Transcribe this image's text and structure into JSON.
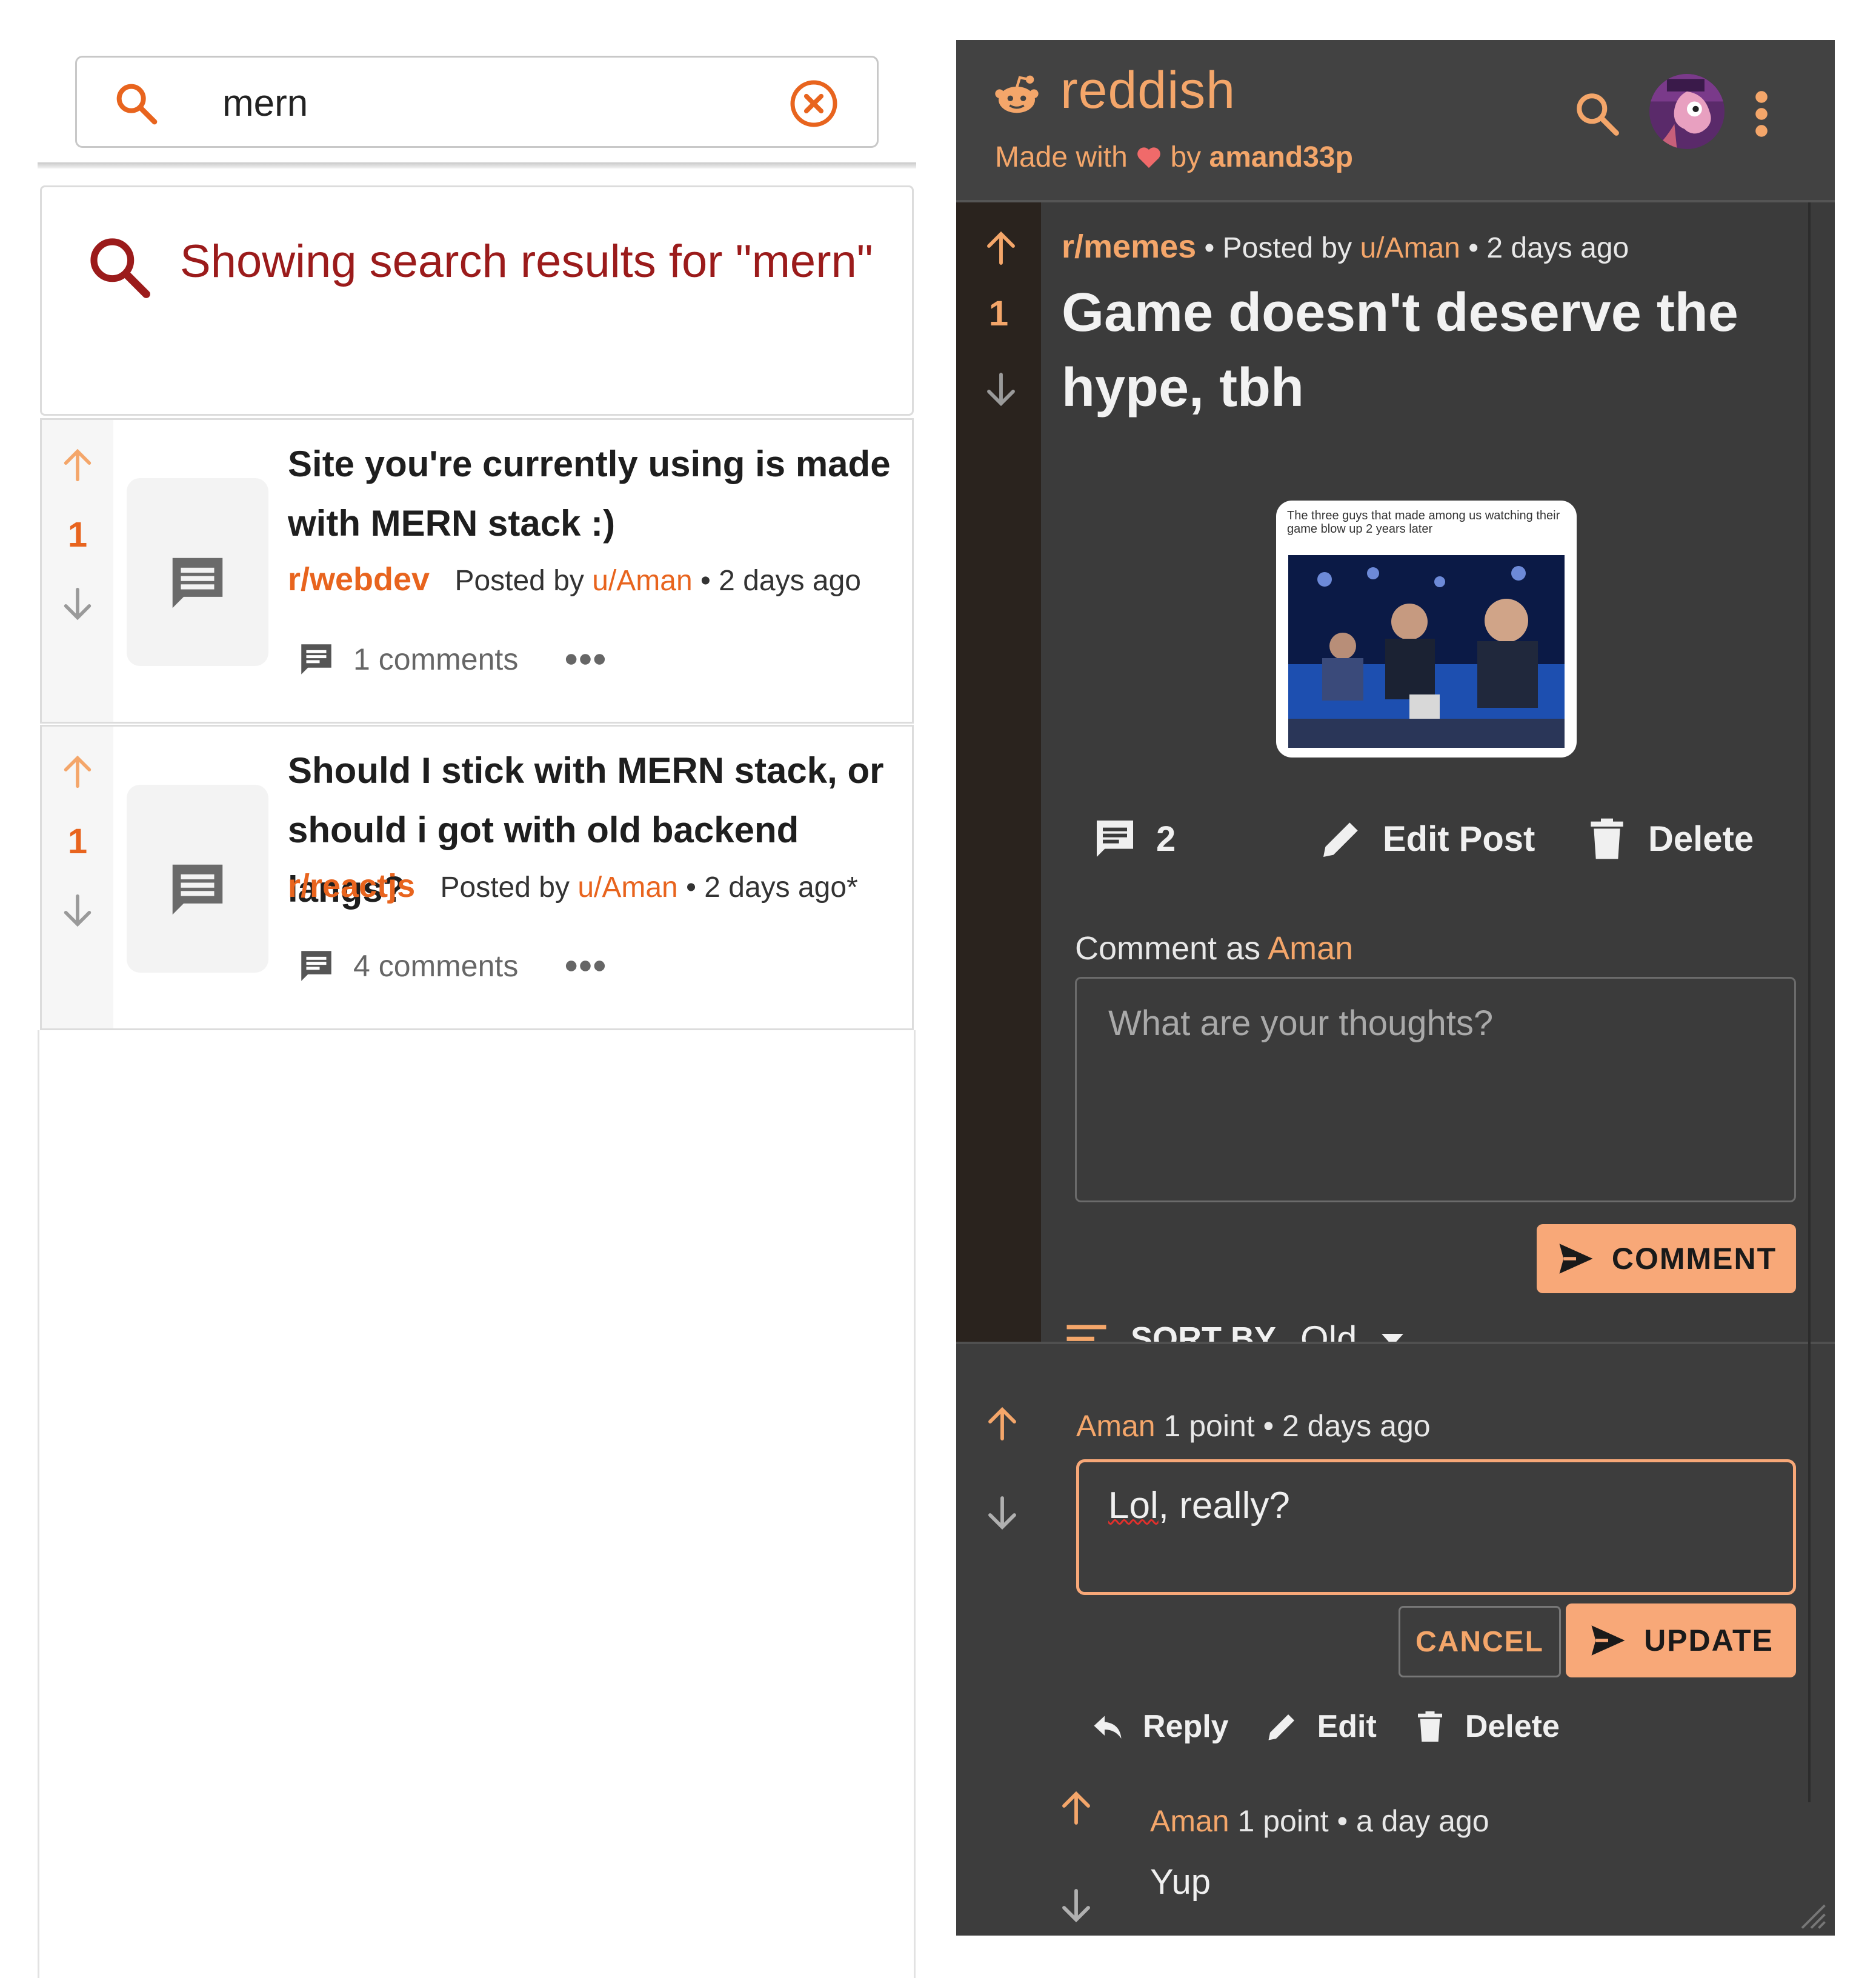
{
  "search": {
    "query": "mern",
    "heading": "Showing search results for \"mern\""
  },
  "results": [
    {
      "score": "1",
      "title": "Site you're currently using is made with MERN stack :)",
      "subreddit": "r/webdev",
      "posted_by": "Posted by",
      "user": "u/Aman",
      "time": "• 2 days ago",
      "comments": "1 comments"
    },
    {
      "score": "1",
      "title": "Should I stick with MERN stack, or should i got with old backend langs?",
      "subreddit": "r/reactjs",
      "posted_by": "Posted by",
      "user": "u/Aman",
      "time": "• 2 days ago*",
      "comments": "4 comments"
    }
  ],
  "app": {
    "name": "reddish",
    "made_with": "Made with",
    "by": "by",
    "author": "amand33p"
  },
  "post": {
    "score": "1",
    "subreddit": "r/memes",
    "posted_by": "• Posted by",
    "user": "u/Aman",
    "time": "• 2 days ago",
    "title": "Game doesn't deserve the hype, tbh",
    "image_caption": "The three guys that made among us watching their game blow up 2 years later",
    "comment_count": "2",
    "edit_label": "Edit Post",
    "delete_label": "Delete"
  },
  "comment_form": {
    "label": "Comment as",
    "user": "Aman",
    "placeholder": "What are your thoughts?",
    "submit_label": "COMMENT"
  },
  "sort": {
    "label": "SORT BY",
    "value": "Old"
  },
  "comments": [
    {
      "user": "Aman",
      "points": "1 point",
      "time": "• 2 days ago",
      "edit_text_a": "Lol",
      "edit_text_b": ", really?",
      "cancel_label": "CANCEL",
      "update_label": "UPDATE",
      "reply_label": "Reply",
      "edit_label": "Edit",
      "delete_label": "Delete"
    },
    {
      "user": "Aman",
      "points": "1 point",
      "time": "• a day ago",
      "body": "Yup"
    }
  ],
  "colors": {
    "accent": "#e8641e",
    "accent_light": "#f4a66a",
    "button": "#f8a878",
    "heading_red": "#9b1b1b",
    "dark_bg": "#3d3d3d"
  }
}
